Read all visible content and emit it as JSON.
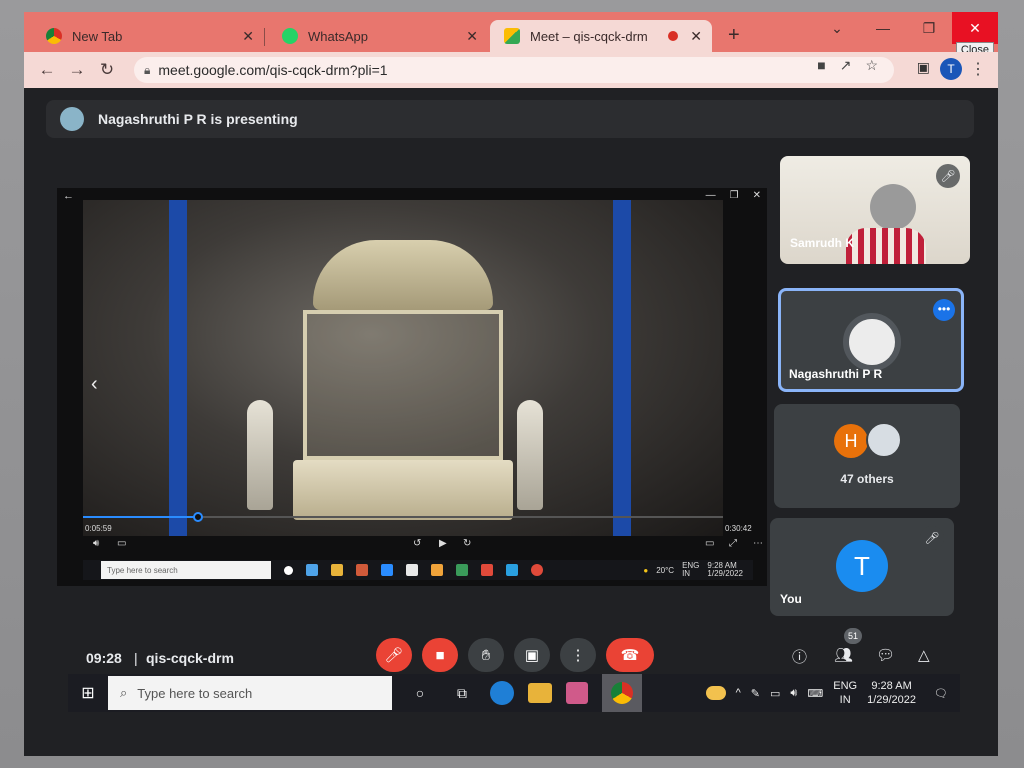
{
  "browser": {
    "tabs": [
      {
        "label": "New Tab",
        "icon": "chrome-icon",
        "active": false
      },
      {
        "label": "WhatsApp",
        "icon": "whatsapp-icon",
        "active": false
      },
      {
        "label": "Meet – qis-cqck-drm",
        "icon": "meet-icon",
        "active": true
      }
    ],
    "new_tab": "+",
    "url": "meet.google.com/qis-cqck-drm?pli=1",
    "profile_initial": "T",
    "close_tooltip": "Close"
  },
  "meet": {
    "presenting_text": "Nagashruthi P R is presenting",
    "presentation": {
      "elapsed": "0:05:59",
      "duration": "0:30:42",
      "progress_fraction": 0.18,
      "inner_search_placeholder": "Type here to search",
      "inner_temp": "20°C",
      "inner_lang_top": "ENG",
      "inner_lang_bottom": "IN",
      "inner_time": "9:28 AM",
      "inner_date": "1/29/2022"
    },
    "participants": {
      "samrudh": "Samrudh K",
      "nagashruthi": "Nagashruthi P R",
      "others_initial": "H",
      "others_label": "47 others",
      "you_initial": "T",
      "you_label": "You"
    },
    "bottom_bar": {
      "time": "09:28",
      "separator": "|",
      "meeting_code": "qis-cqck-drm",
      "people_count": "51"
    }
  },
  "taskbar": {
    "search_placeholder": "Type here to search",
    "lang_top": "ENG",
    "lang_bottom": "IN",
    "time": "9:28 AM",
    "date": "1/29/2022"
  },
  "colors": {
    "tab_strip": "#e8766e",
    "meet_bg": "#202124",
    "red_button": "#ea4335",
    "accent_blue": "#1a73e8"
  }
}
